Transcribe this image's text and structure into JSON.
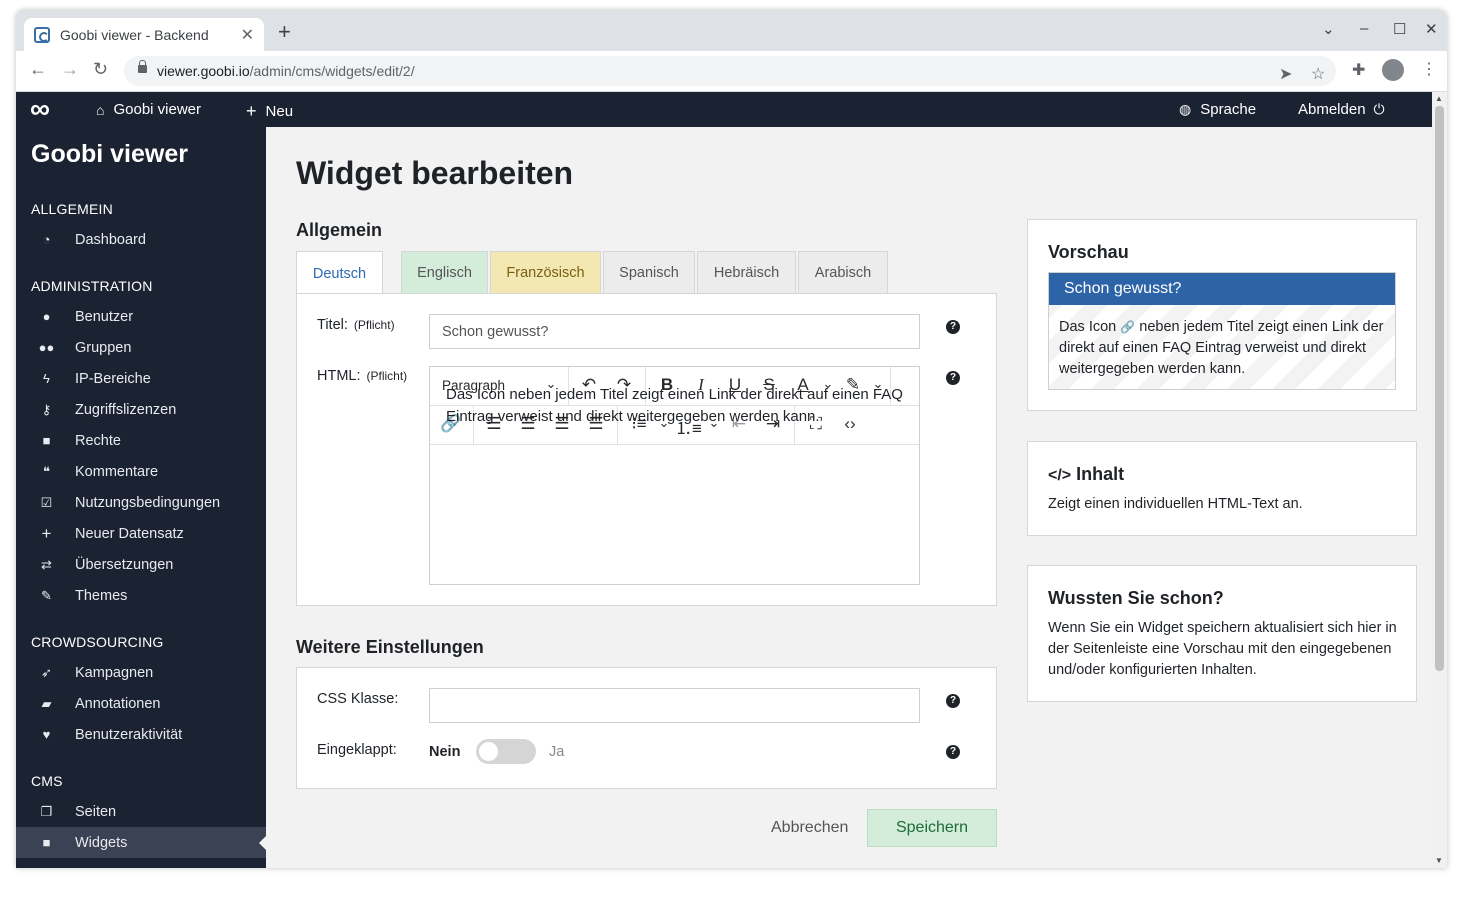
{
  "browser": {
    "tab_title": "Goobi viewer - Backend",
    "tab_close": "✕",
    "new_tab": "+",
    "url_host": "viewer.goobi.io",
    "url_path": "/admin/cms/widgets/edit/2/"
  },
  "topnav": {
    "home_label": "Goobi viewer",
    "new_label": "Neu",
    "language_label": "Sprache",
    "logout_label": "Abmelden"
  },
  "sidebar": {
    "brand": "Goobi viewer",
    "sections": [
      {
        "heading": "ALLGEMEIN",
        "items": [
          {
            "label": "Dashboard",
            "icon": "dashboard-icon"
          }
        ]
      },
      {
        "heading": "ADMINISTRATION",
        "items": [
          {
            "label": "Benutzer",
            "icon": "user-icon"
          },
          {
            "label": "Gruppen",
            "icon": "users-icon"
          },
          {
            "label": "IP-Bereiche",
            "icon": "bolt-icon"
          },
          {
            "label": "Zugriffslizenzen",
            "icon": "key-icon"
          },
          {
            "label": "Rechte",
            "icon": "lock-icon"
          },
          {
            "label": "Kommentare",
            "icon": "comments-icon"
          },
          {
            "label": "Nutzungsbedingungen",
            "icon": "check-square-icon"
          },
          {
            "label": "Neuer Datensatz",
            "icon": "plus-icon"
          },
          {
            "label": "Übersetzungen",
            "icon": "exchange-icon"
          },
          {
            "label": "Themes",
            "icon": "brush-icon"
          }
        ]
      },
      {
        "heading": "CROWDSOURCING",
        "items": [
          {
            "label": "Kampagnen",
            "icon": "rocket-icon"
          },
          {
            "label": "Annotationen",
            "icon": "sticky-note-icon"
          },
          {
            "label": "Benutzeraktivität",
            "icon": "heartbeat-icon"
          }
        ]
      },
      {
        "heading": "CMS",
        "items": [
          {
            "label": "Seiten",
            "icon": "pages-icon"
          },
          {
            "label": "Widgets",
            "icon": "widget-icon",
            "active": true
          }
        ]
      }
    ]
  },
  "main": {
    "page_title": "Widget bearbeiten",
    "general_title": "Allgemein",
    "language_tabs": [
      {
        "label": "Deutsch",
        "state": "active"
      },
      {
        "label": "Englisch",
        "state": "complete"
      },
      {
        "label": "Französisch",
        "state": "partial"
      },
      {
        "label": "Spanisch",
        "state": "empty"
      },
      {
        "label": "Hebräisch",
        "state": "empty"
      },
      {
        "label": "Arabisch",
        "state": "empty"
      }
    ],
    "title_label": "Titel:",
    "required_label": "(Pflicht)",
    "title_value": "Schon gewusst?",
    "html_label": "HTML:",
    "editor": {
      "format_select": "Paragraph",
      "content": "Das Icon neben jedem Titel zeigt einen Link der direkt auf einen FAQ Eintrag verweist und direkt weitergegeben werden kann."
    },
    "further_settings_title": "Weitere Einstellungen",
    "css_class_label": "CSS Klasse:",
    "css_class_value": "",
    "collapsed_label": "Eingeklappt:",
    "toggle_off": "Nein",
    "toggle_on": "Ja",
    "toggle_value": false,
    "cancel_label": "Abbrechen",
    "save_label": "Speichern"
  },
  "right": {
    "preview_title": "Vorschau",
    "preview_widget_title": "Schon gewusst?",
    "preview_text_before": "Das Icon",
    "preview_text_after": "neben jedem Titel zeigt einen Link der direkt auf einen FAQ Eintrag verweist und direkt weitergegeben werden kann.",
    "content_title": "Inhalt",
    "content_text": "Zeigt einen individuellen HTML-Text an.",
    "tip_title": "Wussten Sie schon?",
    "tip_text": "Wenn Sie ein Widget speichern aktualisiert sich hier in der Seitenleiste eine Vorschau mit den eingegebenen und/oder konfigurierten Inhalten."
  },
  "colors": {
    "sidebar_bg": "#1b2232",
    "preview_head": "#2d63a7",
    "save_bg": "#d4edda",
    "tab_active_text": "#2d6ab3"
  }
}
